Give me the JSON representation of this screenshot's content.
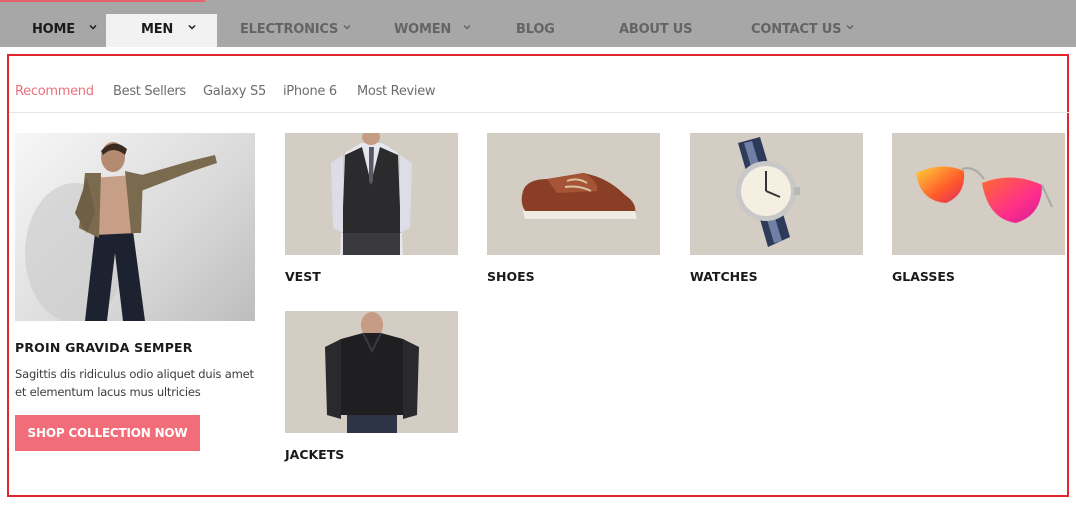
{
  "nav": {
    "items": [
      {
        "label": "HOME",
        "has_dropdown": true
      },
      {
        "label": "MEN",
        "has_dropdown": true,
        "active": true
      },
      {
        "label": "ELECTRONICS",
        "has_dropdown": true
      },
      {
        "label": "WOMEN",
        "has_dropdown": true
      },
      {
        "label": "BLOG",
        "has_dropdown": false
      },
      {
        "label": "ABOUT US",
        "has_dropdown": false
      },
      {
        "label": "CONTACT US",
        "has_dropdown": true
      }
    ],
    "icons": {
      "dropdown": "chevron-down-icon"
    },
    "colors": {
      "bar": "#a7a7a7",
      "active_bg": "#f2f2f2",
      "accent": "#e8636e"
    }
  },
  "tabs": {
    "items": [
      {
        "label": "Recommend",
        "active": true
      },
      {
        "label": "Best Sellers"
      },
      {
        "label": "Galaxy S5"
      },
      {
        "label": "iPhone 6"
      },
      {
        "label": "Most Review"
      }
    ],
    "active_color": "#e8737c"
  },
  "promo": {
    "image": "man-in-jacket-photo",
    "title": "PROIN GRAVIDA SEMPER",
    "description": "Sagittis dis ridiculus odio aliquet duis amet et elementum lacus mus ultricies",
    "button_label": "SHOP COLLECTION NOW",
    "button_color": "#f06d79"
  },
  "products": [
    {
      "name": "VEST",
      "image": "vest-photo"
    },
    {
      "name": "SHOES",
      "image": "shoes-photo"
    },
    {
      "name": "WATCHES",
      "image": "watch-photo"
    },
    {
      "name": "GLASSES",
      "image": "sunglasses-photo"
    },
    {
      "name": "JACKETS",
      "image": "leather-jacket-photo"
    }
  ],
  "panel_border_color": "#e3262c"
}
